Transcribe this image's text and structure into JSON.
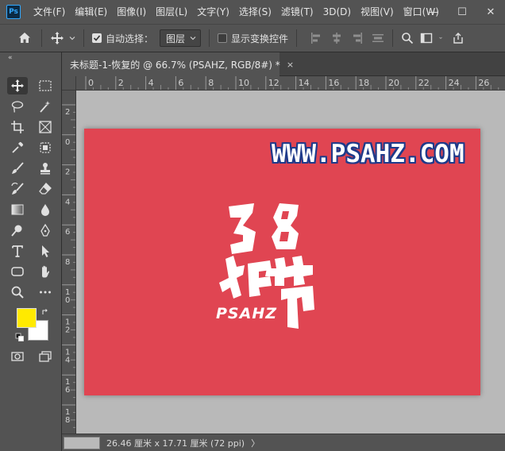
{
  "app": {
    "logo": "Ps"
  },
  "menu": [
    "文件(F)",
    "编辑(E)",
    "图像(I)",
    "图层(L)",
    "文字(Y)",
    "选择(S)",
    "滤镜(T)",
    "3D(D)",
    "视图(V)",
    "窗口(W)"
  ],
  "window_controls": {
    "minimize": "—",
    "maximize": "☐",
    "close": "✕"
  },
  "options": {
    "auto_select_label": "自动选择：",
    "auto_select_checked": true,
    "target_select_value": "图层",
    "show_transform_label": "显示变换控件",
    "show_transform_checked": false
  },
  "document": {
    "tab_title": "未标题-1-恢复的 @ 66.7% (PSAHZ, RGB/8#) *",
    "close_glyph": "×"
  },
  "rulers": {
    "top_ticks": [
      "0",
      "2",
      "4",
      "6",
      "8",
      "10",
      "12",
      "14",
      "16",
      "18",
      "20",
      "22",
      "24",
      "26"
    ],
    "left_ticks": [
      "2",
      "0",
      "2",
      "4",
      "6",
      "8",
      "1 0",
      "1 2",
      "1 4",
      "1 6",
      "1 8"
    ]
  },
  "canvas": {
    "background_color": "#e04552",
    "site_text": "WWW.PSAHZ.COM",
    "logo_word": "PSAHZ"
  },
  "colors": {
    "foreground": "#ffea00",
    "background": "#ffffff"
  },
  "status": {
    "doc_size": "26.46 厘米 x 17.71 厘米 (72 ppi)",
    "arrow": "〉"
  },
  "tools": [
    "move-tool",
    "marquee-tool",
    "lasso-tool",
    "magic-wand-tool",
    "crop-tool",
    "frame-tool",
    "eyedropper-tool",
    "patch-tool",
    "brush-tool",
    "stamp-tool",
    "history-brush-tool",
    "eraser-tool",
    "gradient-tool",
    "blur-tool",
    "dodge-tool",
    "pen-tool",
    "type-tool",
    "path-select-tool",
    "shape-tool",
    "hand-tool",
    "zoom-tool",
    "more-tools",
    "quick-mask",
    "screen-mode"
  ]
}
